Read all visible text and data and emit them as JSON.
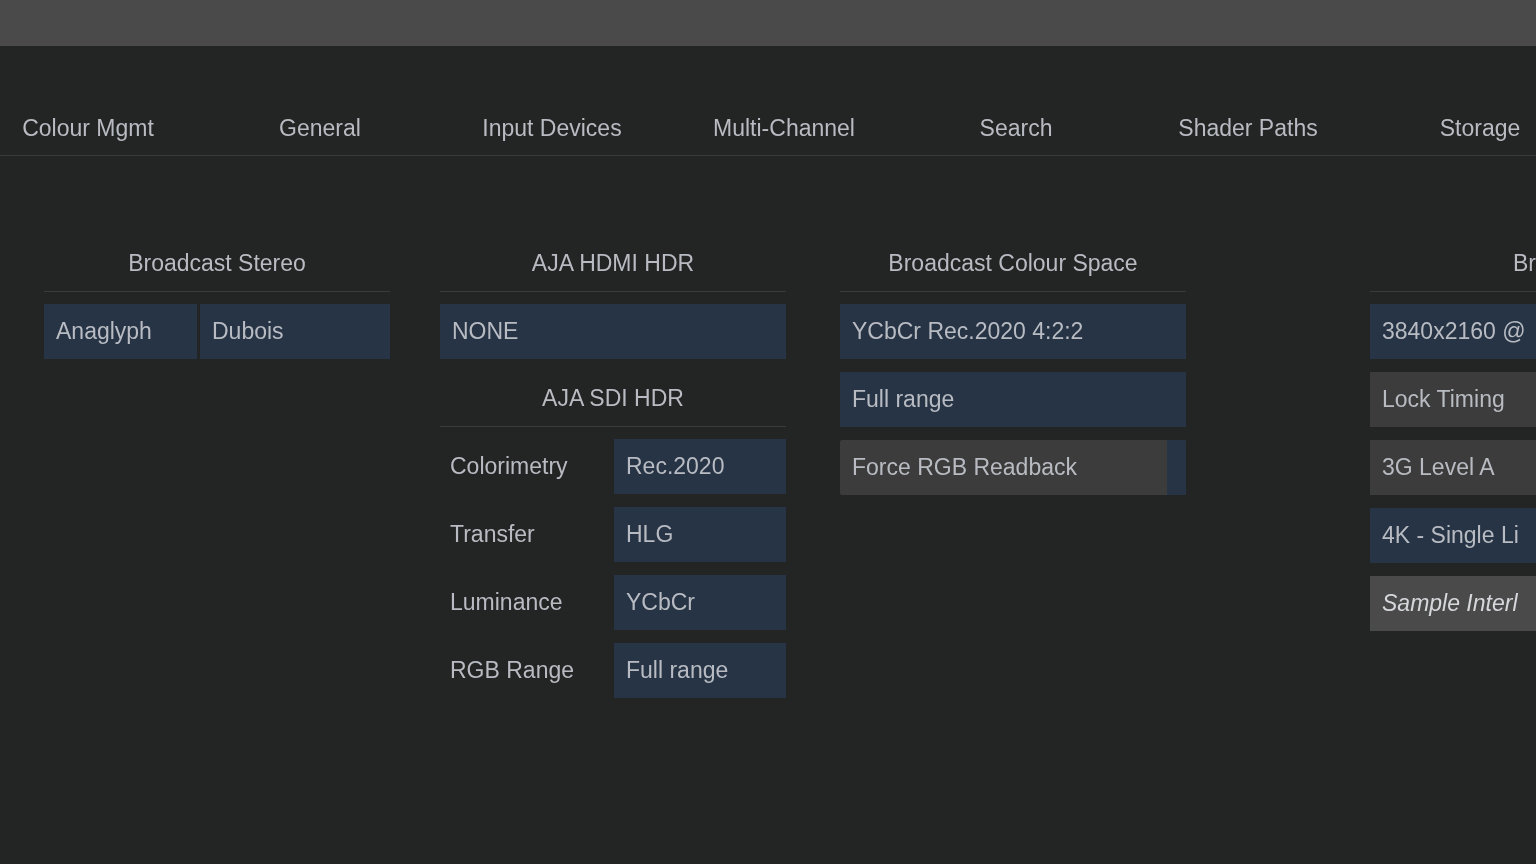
{
  "tabs": [
    {
      "label": "Colour Mgmt"
    },
    {
      "label": "General"
    },
    {
      "label": "Input Devices"
    },
    {
      "label": "Multi-Channel"
    },
    {
      "label": "Search"
    },
    {
      "label": "Shader Paths"
    },
    {
      "label": "Storage"
    }
  ],
  "columns": [
    {
      "sections": [
        {
          "title": "Broadcast Stereo",
          "rows": [
            {
              "kind": "dropdown_pair",
              "values": [
                "Anaglyph",
                "Dubois"
              ]
            }
          ]
        }
      ]
    },
    {
      "sections": [
        {
          "title": "AJA HDMI HDR",
          "rows": [
            {
              "kind": "dropdown",
              "value": "NONE"
            }
          ]
        },
        {
          "title": "AJA SDI HDR",
          "rows": [
            {
              "kind": "labeled_dropdown",
              "label": "Colorimetry",
              "value": "Rec.2020"
            },
            {
              "kind": "labeled_dropdown",
              "label": "Transfer",
              "value": "HLG"
            },
            {
              "kind": "labeled_dropdown",
              "label": "Luminance",
              "value": "YCbCr"
            },
            {
              "kind": "labeled_dropdown",
              "label": "RGB Range",
              "value": "Full range"
            }
          ]
        }
      ]
    },
    {
      "sections": [
        {
          "title": "Broadcast Colour Space",
          "rows": [
            {
              "kind": "dropdown",
              "value": "YCbCr Rec.2020 4:2:2"
            },
            {
              "kind": "dropdown",
              "value": "Full range"
            },
            {
              "kind": "toggle",
              "label": "Force RGB Readback",
              "on": false
            }
          ]
        }
      ]
    },
    {
      "sections": [
        {
          "title": "Br",
          "rows": [
            {
              "kind": "dropdown",
              "value": "3840x2160 @"
            },
            {
              "kind": "button",
              "label": "Lock Timing"
            },
            {
              "kind": "button",
              "label": "3G Level A"
            },
            {
              "kind": "dropdown",
              "value": "4K - Single Li"
            },
            {
              "kind": "hint_button",
              "label": "Sample Interl"
            }
          ]
        }
      ]
    }
  ]
}
